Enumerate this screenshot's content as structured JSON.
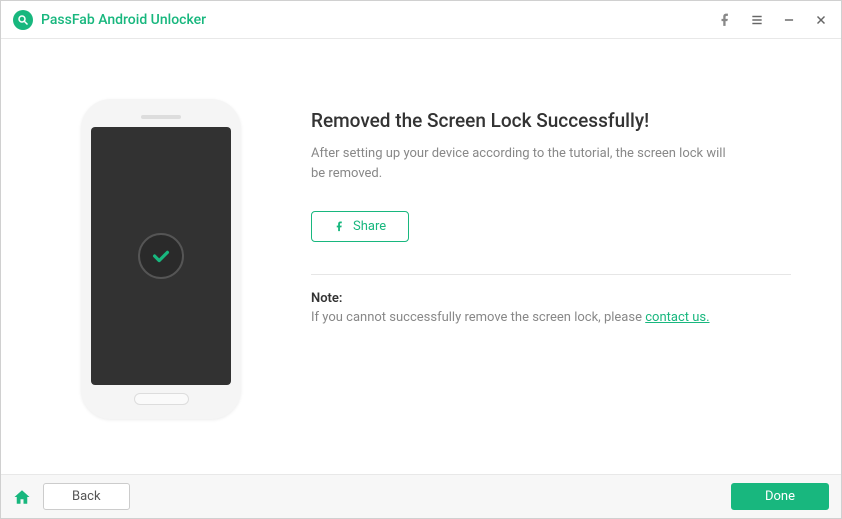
{
  "app": {
    "title": "PassFab Android Unlocker"
  },
  "window": {
    "facebook_icon": "facebook",
    "menu_icon": "menu",
    "min_icon": "minimize",
    "close_icon": "close"
  },
  "content": {
    "headline": "Removed the Screen Lock Successfully!",
    "subtext": "After setting up your device according to the tutorial, the screen lock will be removed.",
    "share_label": "Share",
    "note_title": "Note:",
    "note_text": "If you cannot successfully remove the screen lock, please ",
    "contact_label": "contact us.",
    "check_icon": "checkmark"
  },
  "footer": {
    "home_icon": "home",
    "back_label": "Back",
    "done_label": "Done"
  },
  "colors": {
    "accent": "#18b77e",
    "text_muted": "#888"
  }
}
